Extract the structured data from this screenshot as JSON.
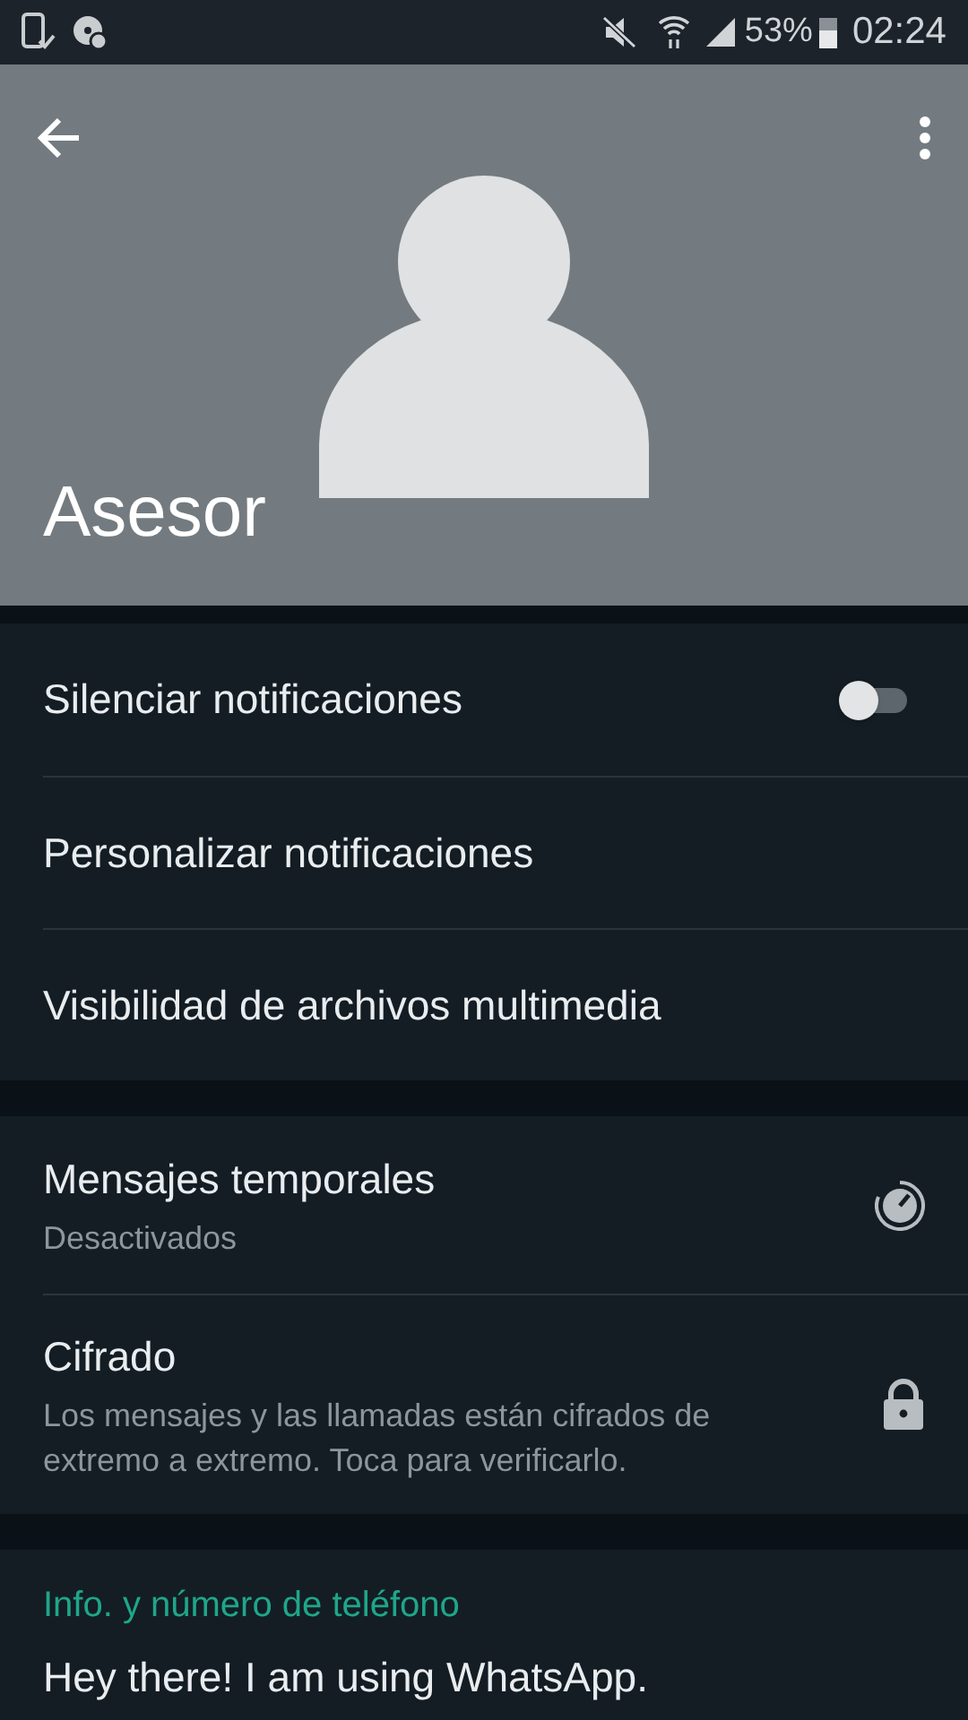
{
  "status_bar": {
    "battery": "53%",
    "time": "02:24"
  },
  "header": {
    "name": "Asesor"
  },
  "notification_settings": [
    {
      "kind": "toggle",
      "label": "Silenciar notificaciones",
      "on": false
    },
    {
      "kind": "plain",
      "label": "Personalizar notificaciones"
    },
    {
      "kind": "plain",
      "label": "Visibilidad de archivos multimedia"
    }
  ],
  "privacy": [
    {
      "kind": "timer",
      "title": "Mensajes temporales",
      "subtitle": "Desactivados"
    },
    {
      "kind": "lock",
      "title": "Cifrado",
      "subtitle": "Los mensajes y las llamadas están cifrados de extremo a extremo. Toca para verificarlo."
    }
  ],
  "info": {
    "heading": "Info. y número de teléfono",
    "about": "Hey there! I am using WhatsApp."
  }
}
